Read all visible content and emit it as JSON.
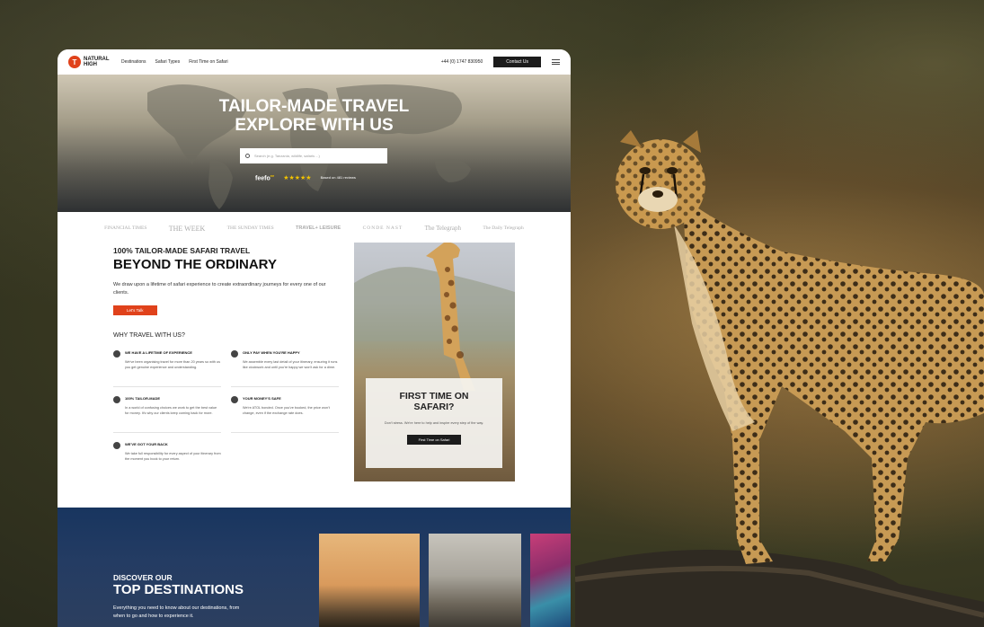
{
  "nav": {
    "logo_line1": "NATURAL",
    "logo_line2": "HIGH",
    "links": [
      "Destinations",
      "Safari Types",
      "First Time on Safari"
    ],
    "phone": "+44 (0) 1747 830950",
    "contact_label": "Contact Us"
  },
  "hero": {
    "title_line1": "TAILOR-MADE TRAVEL",
    "title_line2": "EXPLORE WITH US",
    "search_placeholder": "Search (e.g. Tanzania, wildlife, safaris ...)",
    "feefo": "feefo",
    "feefo_mark": "ee",
    "stars": "★★★★★",
    "review_text": "Based on 481 reviews"
  },
  "press": [
    "FINANCIAL TIMES",
    "THE WEEK",
    "THE SUNDAY TIMES",
    "TRAVEL+ LEISURE",
    "CONDE NAST",
    "The Telegraph",
    "The Daily Telegraph"
  ],
  "intro": {
    "kicker": "100% TAILOR-MADE SAFARI TRAVEL",
    "headline": "BEYOND THE ORDINARY",
    "lead": "We draw upon a lifetime of safari experience to create extraordinary journeys for every one of our clients.",
    "cta": "Let's Talk",
    "why_title": "WHY TRAVEL WITH US?"
  },
  "features": [
    {
      "title": "WE HAVE A LIFETIME OF EXPERIENCE",
      "text": "We've been organising travel for more than 20 years so with us you get genuine experience and understanding."
    },
    {
      "title": "ONLY PAY WHEN YOU'RE HAPPY",
      "text": "We assemble every last detail of your itinerary, ensuring it runs like clockwork and until you're happy we won't ask for a dime."
    },
    {
      "title": "100% TAILOR-MADE",
      "text": "In a world of confusing choices we work to get the best value for money. It's why our clients keep coming back for more."
    },
    {
      "title": "YOUR MONEY'S SAFE",
      "text": "We're ATOL bonded. Once you've booked, the price won't change, even if the exchange rate does."
    },
    {
      "title": "WE'VE GOT YOUR BACK",
      "text": "We take full responsibility for every aspect of your itinerary from the moment you book to your return."
    }
  ],
  "first_time": {
    "title_line1": "FIRST TIME ON",
    "title_line2": "SAFARI?",
    "text": "Don't stress. We're here to help and inspire every step of the way.",
    "cta": "First Time on Safari"
  },
  "destinations": {
    "kicker": "DISCOVER OUR",
    "headline": "TOP DESTINATIONS",
    "text": "Everything you need to know about our destinations, from when to go and how to experience it."
  }
}
